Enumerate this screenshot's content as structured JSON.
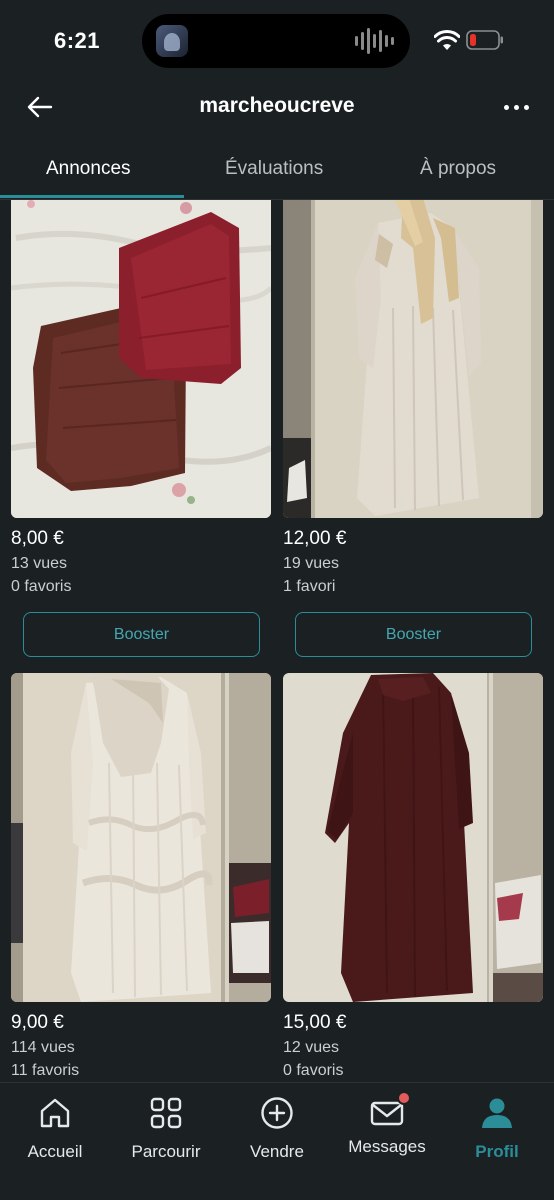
{
  "status_bar": {
    "time": "6:21"
  },
  "header": {
    "title": "marcheoucreve"
  },
  "tabs": [
    {
      "label": "Annonces",
      "active": true
    },
    {
      "label": "Évaluations",
      "active": false
    },
    {
      "label": "À propos",
      "active": false
    }
  ],
  "listings": [
    {
      "price": "8,00 €",
      "views": "13 vues",
      "favorites": "0 favoris",
      "button": "Booster",
      "image": "folded-scarves"
    },
    {
      "price": "12,00 €",
      "views": "19 vues",
      "favorites": "1 favori",
      "button": "Booster",
      "image": "beige-dress"
    },
    {
      "price": "9,00 €",
      "views": "114 vues",
      "favorites": "11 favoris",
      "image": "ruffled-dress"
    },
    {
      "price": "15,00 €",
      "views": "12 vues",
      "favorites": "0 favoris",
      "image": "burgundy-abaya"
    }
  ],
  "bottom_nav": [
    {
      "label": "Accueil",
      "icon": "home-icon",
      "active": false
    },
    {
      "label": "Parcourir",
      "icon": "grid-icon",
      "active": false
    },
    {
      "label": "Vendre",
      "icon": "plus-circle-icon",
      "active": false
    },
    {
      "label": "Messages",
      "icon": "mail-icon",
      "active": false,
      "badge": true
    },
    {
      "label": "Profil",
      "icon": "person-icon",
      "active": true
    }
  ],
  "colors": {
    "background": "#1b2123",
    "accent": "#2a8d98",
    "badge": "#e45b5b"
  }
}
